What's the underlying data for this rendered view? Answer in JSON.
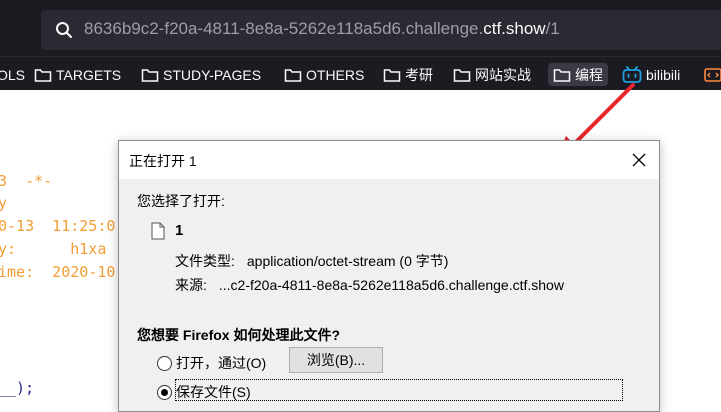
{
  "browser": {
    "url_path_prefix": "8636b9c2-f20a-4811-8e8a-5262e118a5d6.challenge.",
    "url_host": "ctf.show",
    "url_suffix": "/1"
  },
  "bookmarks": [
    {
      "label": "OLS",
      "icon": "none"
    },
    {
      "label": "TARGETS",
      "icon": "folder-icon"
    },
    {
      "label": "STUDY-PAGES",
      "icon": "folder-icon"
    },
    {
      "label": "OTHERS",
      "icon": "folder-icon"
    },
    {
      "label": "考研",
      "icon": "folder-icon"
    },
    {
      "label": "网站实战",
      "icon": "folder-icon"
    },
    {
      "label": "编程",
      "icon": "folder-icon"
    },
    {
      "label": "bilibili",
      "icon": "bilibili-icon"
    }
  ],
  "code_lines": [
    "3  -*-",
    "y",
    "0-13  11:25:0",
    "y:      h1xa",
    "ime:  2020-10",
    "__);"
  ],
  "dialog": {
    "title": "正在打开 1",
    "chosen_label": "您选择了打开:",
    "file_name": "1",
    "type_label": "文件类型:",
    "type_value": "application/octet-stream (0 字节)",
    "source_label": "来源:",
    "source_value": "...c2-f20a-4811-8e8a-5262e118a5d6.challenge.ctf.show",
    "question": "您想要 Firefox 如何处理此文件?",
    "open_with_label": "打开，通过(O)",
    "browse_label": "浏览(B)...",
    "save_label": "保存文件(S)",
    "selected_option": "save"
  },
  "colors": {
    "chrome_bg": "#1c1b22",
    "urlbar_bg": "#2b2a33",
    "code_orange": "#f29d35",
    "arrow_red": "#e8262b"
  }
}
